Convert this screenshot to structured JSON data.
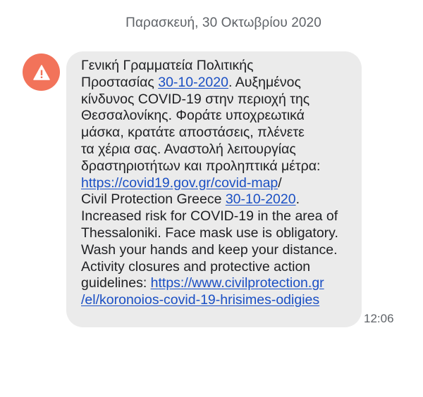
{
  "conversation": {
    "date_header": "Παρασκευή, 30 Οκτωβρίου 2020"
  },
  "message": {
    "sender_icon": "warning-icon",
    "avatar_color": "#f2735a",
    "bubble_color": "#ebebeb",
    "link_color": "#1a4fc4",
    "time": "12:06",
    "lines": {
      "l1": "Γενική Γραμματεία Πολιτικής",
      "l2_before": "Προστασίας ",
      "l2_link": "30-10-2020",
      "l2_after": ". Αυξημένος",
      "l3": "κίνδυνος COVID-19 στην περιοχή της",
      "l4": "Θεσσαλονίκης. Φοράτε υποχρεωτικά",
      "l5": "μάσκα, κρατάτε αποστάσεις, πλένετε",
      "l6": "τα χέρια σας. Αναστολή λειτουργίας",
      "l7": "δραστηριοτήτων και προληπτικά μέτρα:",
      "l8_link": "https://covid19.gov.gr/covid-map",
      "l8_after": "/",
      "l9_before": "Civil Protection Greece ",
      "l9_link": "30-10-2020",
      "l9_after": ".",
      "l10": "Increased risk for COVID-19 in the area of",
      "l11": "Thessaloniki. Face mask use is obligatory.",
      "l12": "Wash your hands and keep your distance.",
      "l13": "Activity closures and protective action",
      "l14_before": "guidelines: ",
      "l14_link": "https://www.civilprotection.gr",
      "l15_link": "/el/koronoios-covid-19-hrisimes-odigies"
    }
  }
}
